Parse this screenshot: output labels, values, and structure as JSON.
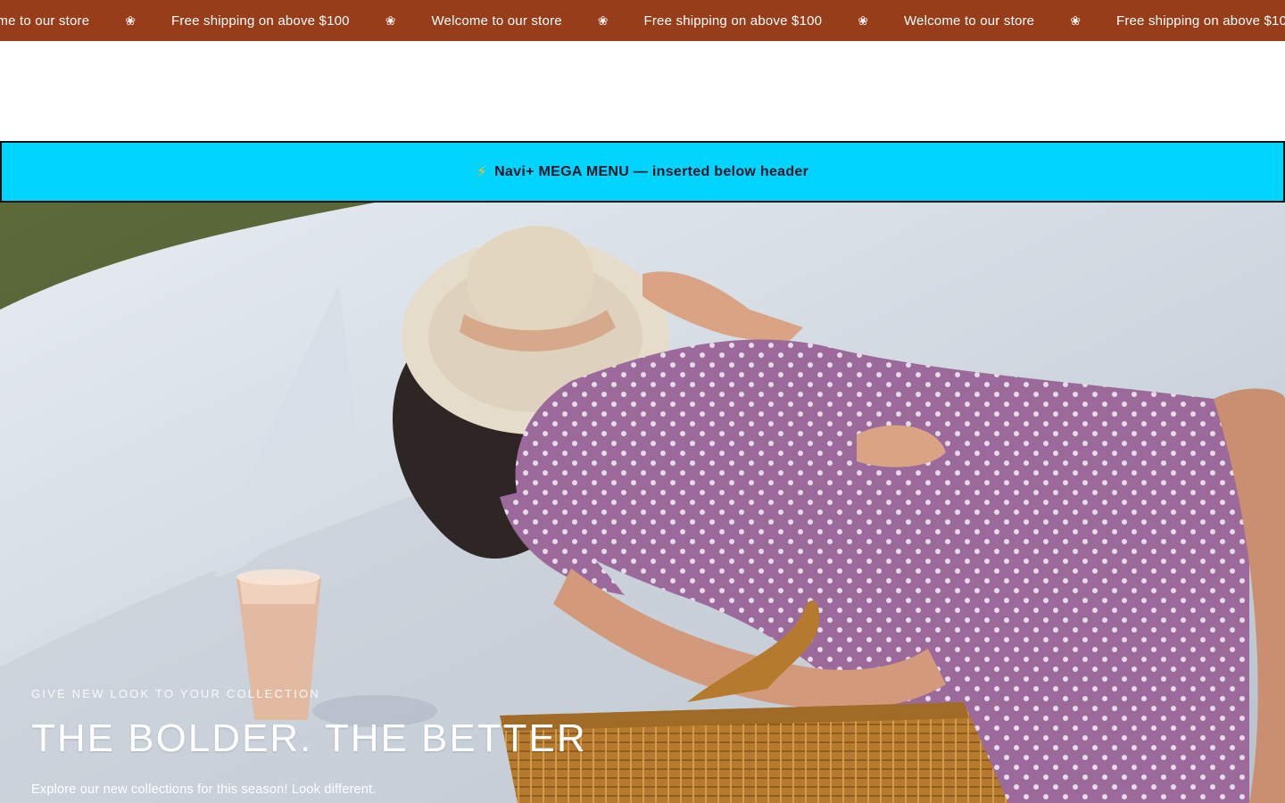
{
  "announcement": {
    "items": [
      "Welcome to our store",
      "Free shipping on above $100",
      "Welcome to our store",
      "Free shipping on above $100",
      "Welcome to our store",
      "Free shipping on above $100"
    ],
    "separator": "❀",
    "background": "#983d1a"
  },
  "mega_banner": {
    "icon": "lightning-icon",
    "text": "Navi+ MEGA MENU — inserted below header",
    "background": "#00d4ff"
  },
  "hero": {
    "eyebrow": "GIVE NEW LOOK TO YOUR COLLECTION",
    "title": "THE BOLDER. THE BETTER",
    "subtitle": "Explore our new collections for this season! Look different."
  }
}
